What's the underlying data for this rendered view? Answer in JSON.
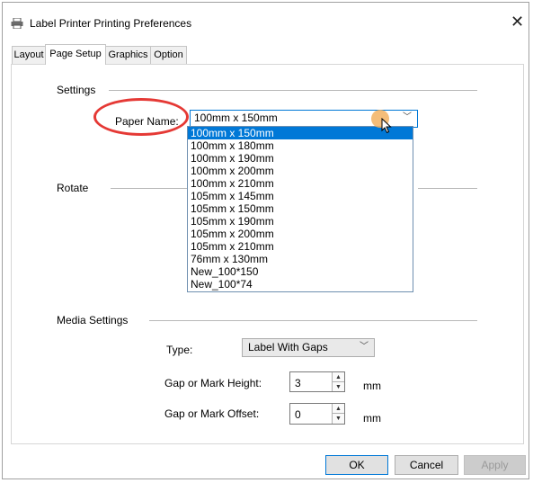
{
  "window": {
    "title": "Label Printer Printing Preferences",
    "close_glyph": "✕"
  },
  "tabs": [
    {
      "label": "Layout",
      "active": false
    },
    {
      "label": "Page Setup",
      "active": true
    },
    {
      "label": "Graphics",
      "active": false
    },
    {
      "label": "Option",
      "active": false
    }
  ],
  "settings": {
    "section_label": "Settings",
    "paper_name_label": "Paper Name:",
    "paper_name_value": "100mm x 150mm"
  },
  "paper_options": [
    "100mm x 150mm",
    "100mm x 180mm",
    "100mm x 190mm",
    "100mm x 200mm",
    "100mm x 210mm",
    "105mm x 145mm",
    "105mm x 150mm",
    "105mm x 190mm",
    "105mm x 200mm",
    "105mm x 210mm",
    "76mm x 130mm",
    "New_100*150",
    "New_100*74"
  ],
  "selected_paper_index": 0,
  "rotate": {
    "section_label": "Rotate"
  },
  "media": {
    "section_label": "Media Settings",
    "type_label": "Type:",
    "type_value": "Label With Gaps",
    "gap_height_label": "Gap or Mark Height:",
    "gap_height_value": "3",
    "gap_height_unit": "mm",
    "gap_offset_label": "Gap or Mark Offset:",
    "gap_offset_value": "0",
    "gap_offset_unit": "mm"
  },
  "buttons": {
    "ok": "OK",
    "cancel": "Cancel",
    "apply": "Apply"
  },
  "colors": {
    "selection": "#0078d7",
    "highlight_ellipse": "#e53935",
    "cursor_dot": "#f2b262"
  }
}
